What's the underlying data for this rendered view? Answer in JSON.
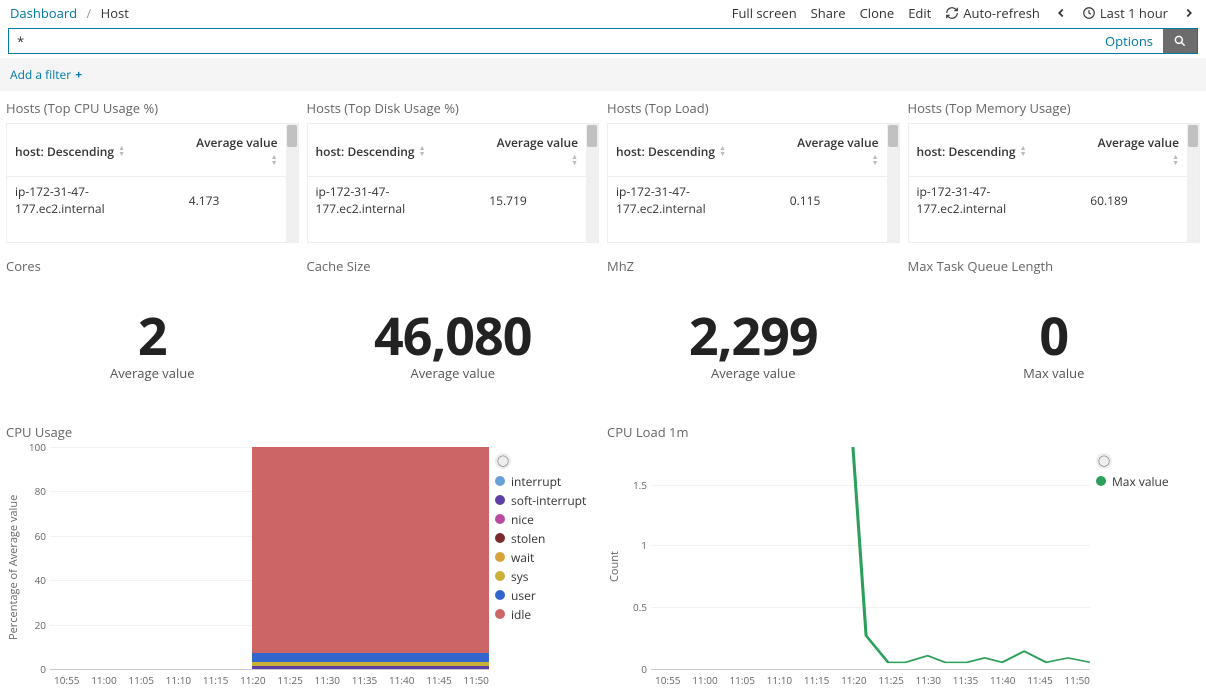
{
  "breadcrumb": {
    "root": "Dashboard",
    "current": "Host"
  },
  "topbar": {
    "fullscreen": "Full screen",
    "share": "Share",
    "clone": "Clone",
    "edit": "Edit",
    "autorefresh": "Auto-refresh",
    "timerange": "Last 1 hour"
  },
  "query": {
    "value": "*",
    "options": "Options"
  },
  "filter": {
    "add": "Add a filter"
  },
  "tables": [
    {
      "title": "Hosts (Top CPU Usage %)",
      "col1": "host: Descending",
      "col2": "Average value",
      "row_host": "ip-172-31-47-177.ec2.internal",
      "row_val": "4.173"
    },
    {
      "title": "Hosts (Top Disk Usage %)",
      "col1": "host: Descending",
      "col2": "Average value",
      "row_host": "ip-172-31-47-177.ec2.internal",
      "row_val": "15.719"
    },
    {
      "title": "Hosts (Top Load)",
      "col1": "host: Descending",
      "col2": "Average value",
      "row_host": "ip-172-31-47-177.ec2.internal",
      "row_val": "0.115"
    },
    {
      "title": "Hosts (Top Memory Usage)",
      "col1": "host: Descending",
      "col2": "Average value",
      "row_host": "ip-172-31-47-177.ec2.internal",
      "row_val": "60.189"
    }
  ],
  "metrics": [
    {
      "title": "Cores",
      "value": "2",
      "label": "Average value"
    },
    {
      "title": "Cache Size",
      "value": "46,080",
      "label": "Average value"
    },
    {
      "title": "MhZ",
      "value": "2,299",
      "label": "Average value"
    },
    {
      "title": "Max Task Queue Length",
      "value": "0",
      "label": "Max value"
    }
  ],
  "charts": {
    "cpu_usage": {
      "title": "CPU Usage",
      "ylabel": "Percentage of Average value",
      "legend": [
        {
          "name": "interrupt",
          "color": "#6aa0d8"
        },
        {
          "name": "soft-interrupt",
          "color": "#5e3fa6"
        },
        {
          "name": "nice",
          "color": "#b94c9e"
        },
        {
          "name": "stolen",
          "color": "#7a2a2a"
        },
        {
          "name": "wait",
          "color": "#d6a23a"
        },
        {
          "name": "sys",
          "color": "#c9b037"
        },
        {
          "name": "user",
          "color": "#3366cc"
        },
        {
          "name": "idle",
          "color": "#c66"
        }
      ]
    },
    "cpu_load": {
      "title": "CPU Load 1m",
      "ylabel": "Count",
      "legend": [
        {
          "name": "Max value",
          "color": "#2ca05a"
        }
      ]
    },
    "xticks": [
      "10:55",
      "11:00",
      "11:05",
      "11:10",
      "11:15",
      "11:20",
      "11:25",
      "11:30",
      "11:35",
      "11:40",
      "11:45",
      "11:50"
    ],
    "y_usage": [
      "0",
      "20",
      "40",
      "60",
      "80",
      "100"
    ],
    "y_load": [
      "0",
      "0.5",
      "1",
      "1.5"
    ]
  },
  "chart_data": [
    {
      "type": "area",
      "title": "CPU Usage",
      "xlabel": "",
      "ylabel": "Percentage of Average value",
      "ylim": [
        0,
        100
      ],
      "x": [
        "10:55",
        "11:00",
        "11:05",
        "11:10",
        "11:15",
        "11:20",
        "11:25",
        "11:30",
        "11:35",
        "11:40",
        "11:45",
        "11:50"
      ],
      "series": [
        {
          "name": "interrupt",
          "values": [
            null,
            null,
            null,
            null,
            null,
            null,
            0,
            0,
            0,
            0,
            0,
            0
          ]
        },
        {
          "name": "soft-interrupt",
          "values": [
            null,
            null,
            null,
            null,
            null,
            null,
            1,
            1,
            1,
            1,
            1,
            1
          ]
        },
        {
          "name": "nice",
          "values": [
            null,
            null,
            null,
            null,
            null,
            null,
            0,
            0,
            0,
            0,
            0,
            0
          ]
        },
        {
          "name": "stolen",
          "values": [
            null,
            null,
            null,
            null,
            null,
            null,
            0,
            0,
            0,
            0,
            0,
            0
          ]
        },
        {
          "name": "wait",
          "values": [
            null,
            null,
            null,
            null,
            null,
            null,
            0,
            0,
            0,
            0,
            0,
            0
          ]
        },
        {
          "name": "sys",
          "values": [
            null,
            null,
            null,
            null,
            null,
            null,
            2,
            2,
            2,
            2,
            2,
            2
          ]
        },
        {
          "name": "user",
          "values": [
            null,
            null,
            null,
            null,
            null,
            null,
            4,
            4,
            4,
            4,
            4,
            4
          ]
        },
        {
          "name": "idle",
          "values": [
            null,
            null,
            null,
            null,
            null,
            null,
            93,
            93,
            93,
            93,
            93,
            93
          ]
        }
      ]
    },
    {
      "type": "line",
      "title": "CPU Load 1m",
      "xlabel": "",
      "ylabel": "Count",
      "ylim": [
        0,
        1.8
      ],
      "x": [
        "10:55",
        "11:00",
        "11:05",
        "11:10",
        "11:15",
        "11:20",
        "11:25",
        "11:30",
        "11:35",
        "11:40",
        "11:45",
        "11:50"
      ],
      "series": [
        {
          "name": "Max value",
          "values": [
            null,
            null,
            null,
            null,
            null,
            null,
            1.8,
            0.05,
            0.05,
            0.1,
            0.05,
            0.1
          ]
        }
      ]
    }
  ]
}
